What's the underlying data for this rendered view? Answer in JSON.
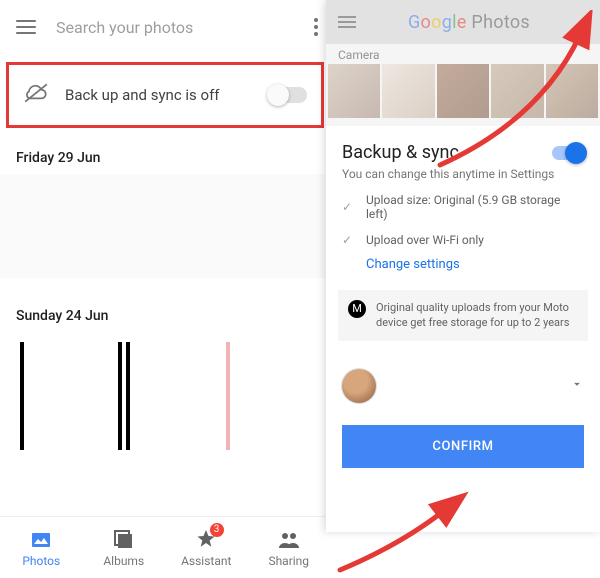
{
  "left": {
    "search_placeholder": "Search your photos",
    "backup_status": "Back up and sync is off",
    "date1": "Friday 29 Jun",
    "date2": "Sunday 24 Jun",
    "nav": {
      "photos": "Photos",
      "albums": "Albums",
      "assistant": "Assistant",
      "assistant_badge": "3",
      "sharing": "Sharing"
    }
  },
  "right": {
    "app_name_google": "Google",
    "app_name_rest": " Photos",
    "album_label": "Camera",
    "sheet_title": "Backup & sync",
    "sheet_subtitle": "You can change this anytime in Settings",
    "check1": "Upload size: Original (5.9 GB storage left)",
    "check2": "Upload over Wi-Fi only",
    "change_settings": "Change settings",
    "promo": "Original quality uploads from your Moto device get free storage for up to 2 years",
    "confirm": "CONFIRM"
  }
}
